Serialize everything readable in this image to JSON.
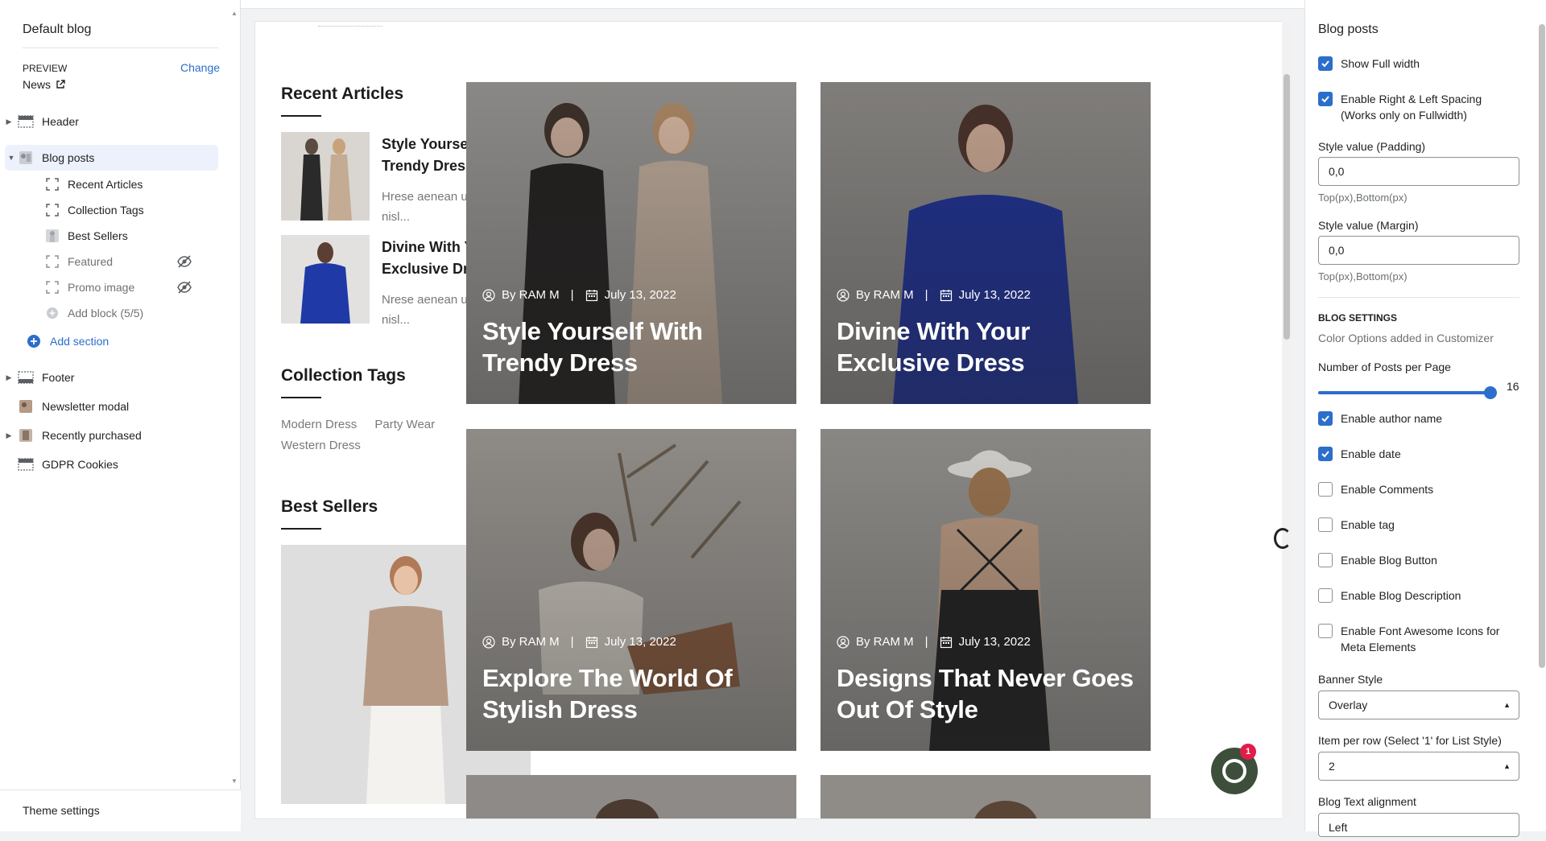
{
  "left_panel": {
    "title": "Default blog",
    "preview_label": "PREVIEW",
    "change_label": "Change",
    "preview_page": "News",
    "sections": [
      {
        "label": "Header",
        "icon": "header-icon"
      },
      {
        "label": "Blog posts",
        "icon": "blog-thumb-icon"
      },
      {
        "label": "Footer",
        "icon": "footer-icon"
      },
      {
        "label": "Newsletter modal",
        "icon": "newsletter-thumb-icon"
      },
      {
        "label": "Recently purchased",
        "icon": "recently-thumb-icon"
      },
      {
        "label": "GDPR Cookies",
        "icon": "gdpr-icon"
      }
    ],
    "blocks": [
      {
        "label": "Recent Articles"
      },
      {
        "label": "Collection Tags"
      },
      {
        "label": "Best Sellers"
      },
      {
        "label": "Featured",
        "hidden": true
      },
      {
        "label": "Promo image",
        "hidden": true
      }
    ],
    "add_block": "Add block (5/5)",
    "add_section": "Add section",
    "theme_settings": "Theme settings"
  },
  "preview": {
    "recent_articles": {
      "title": "Recent Articles",
      "items": [
        {
          "title": "Style Yourself With Trendy Dress",
          "excerpt": "Hrese aenean ut eros et nisl..."
        },
        {
          "title": "Divine With Your Exclusive Dress",
          "excerpt": "Nrese aenean ut eros et nisl..."
        }
      ]
    },
    "collection_tags": {
      "title": "Collection Tags",
      "tags": [
        "Modern Dress",
        "Party Wear",
        "Western Dress"
      ]
    },
    "best_sellers": {
      "title": "Best Sellers"
    },
    "posts": [
      {
        "author": "By RAM M",
        "date": "July 13, 2022",
        "title": "Style Yourself With Trendy Dress"
      },
      {
        "author": "By RAM M",
        "date": "July 13, 2022",
        "title": "Divine With Your Exclusive Dress"
      },
      {
        "author": "By RAM M",
        "date": "July 13, 2022",
        "title": "Explore The World Of Stylish Dress"
      },
      {
        "author": "By RAM M",
        "date": "July 13, 2022",
        "title": "Designs That Never Goes Out Of Style"
      }
    ],
    "meta_separator": "|",
    "chat_badge": "1"
  },
  "settings": {
    "title": "Blog posts",
    "show_full_width": {
      "label": "Show Full width",
      "checked": true
    },
    "enable_spacing": {
      "label": "Enable Right & Left Spacing (Works only on Fullwidth)",
      "checked": true
    },
    "padding": {
      "label": "Style value (Padding)",
      "value": "0,0",
      "help": "Top(px),Bottom(px)"
    },
    "margin": {
      "label": "Style value (Margin)",
      "value": "0,0",
      "help": "Top(px),Bottom(px)"
    },
    "blog_settings_heading": "BLOG SETTINGS",
    "blog_settings_sub": "Color Options added in Customizer",
    "posts_per_page": {
      "label": "Number of Posts per Page",
      "value": "16"
    },
    "checkboxes": [
      {
        "label": "Enable author name",
        "checked": true
      },
      {
        "label": "Enable date",
        "checked": true
      },
      {
        "label": "Enable Comments",
        "checked": false
      },
      {
        "label": "Enable tag",
        "checked": false
      },
      {
        "label": "Enable Blog Button",
        "checked": false
      },
      {
        "label": "Enable Blog Description",
        "checked": false
      },
      {
        "label": "Enable Font Awesome Icons for Meta Elements",
        "checked": false
      }
    ],
    "banner_style": {
      "label": "Banner Style",
      "value": "Overlay"
    },
    "item_per_row": {
      "label": "Item per row (Select '1' for List Style)",
      "value": "2"
    },
    "text_alignment": {
      "label": "Blog Text alignment",
      "value": "Left"
    }
  },
  "colors": {
    "accent": "#2c6ecb",
    "active_row": "#edf1fb"
  }
}
